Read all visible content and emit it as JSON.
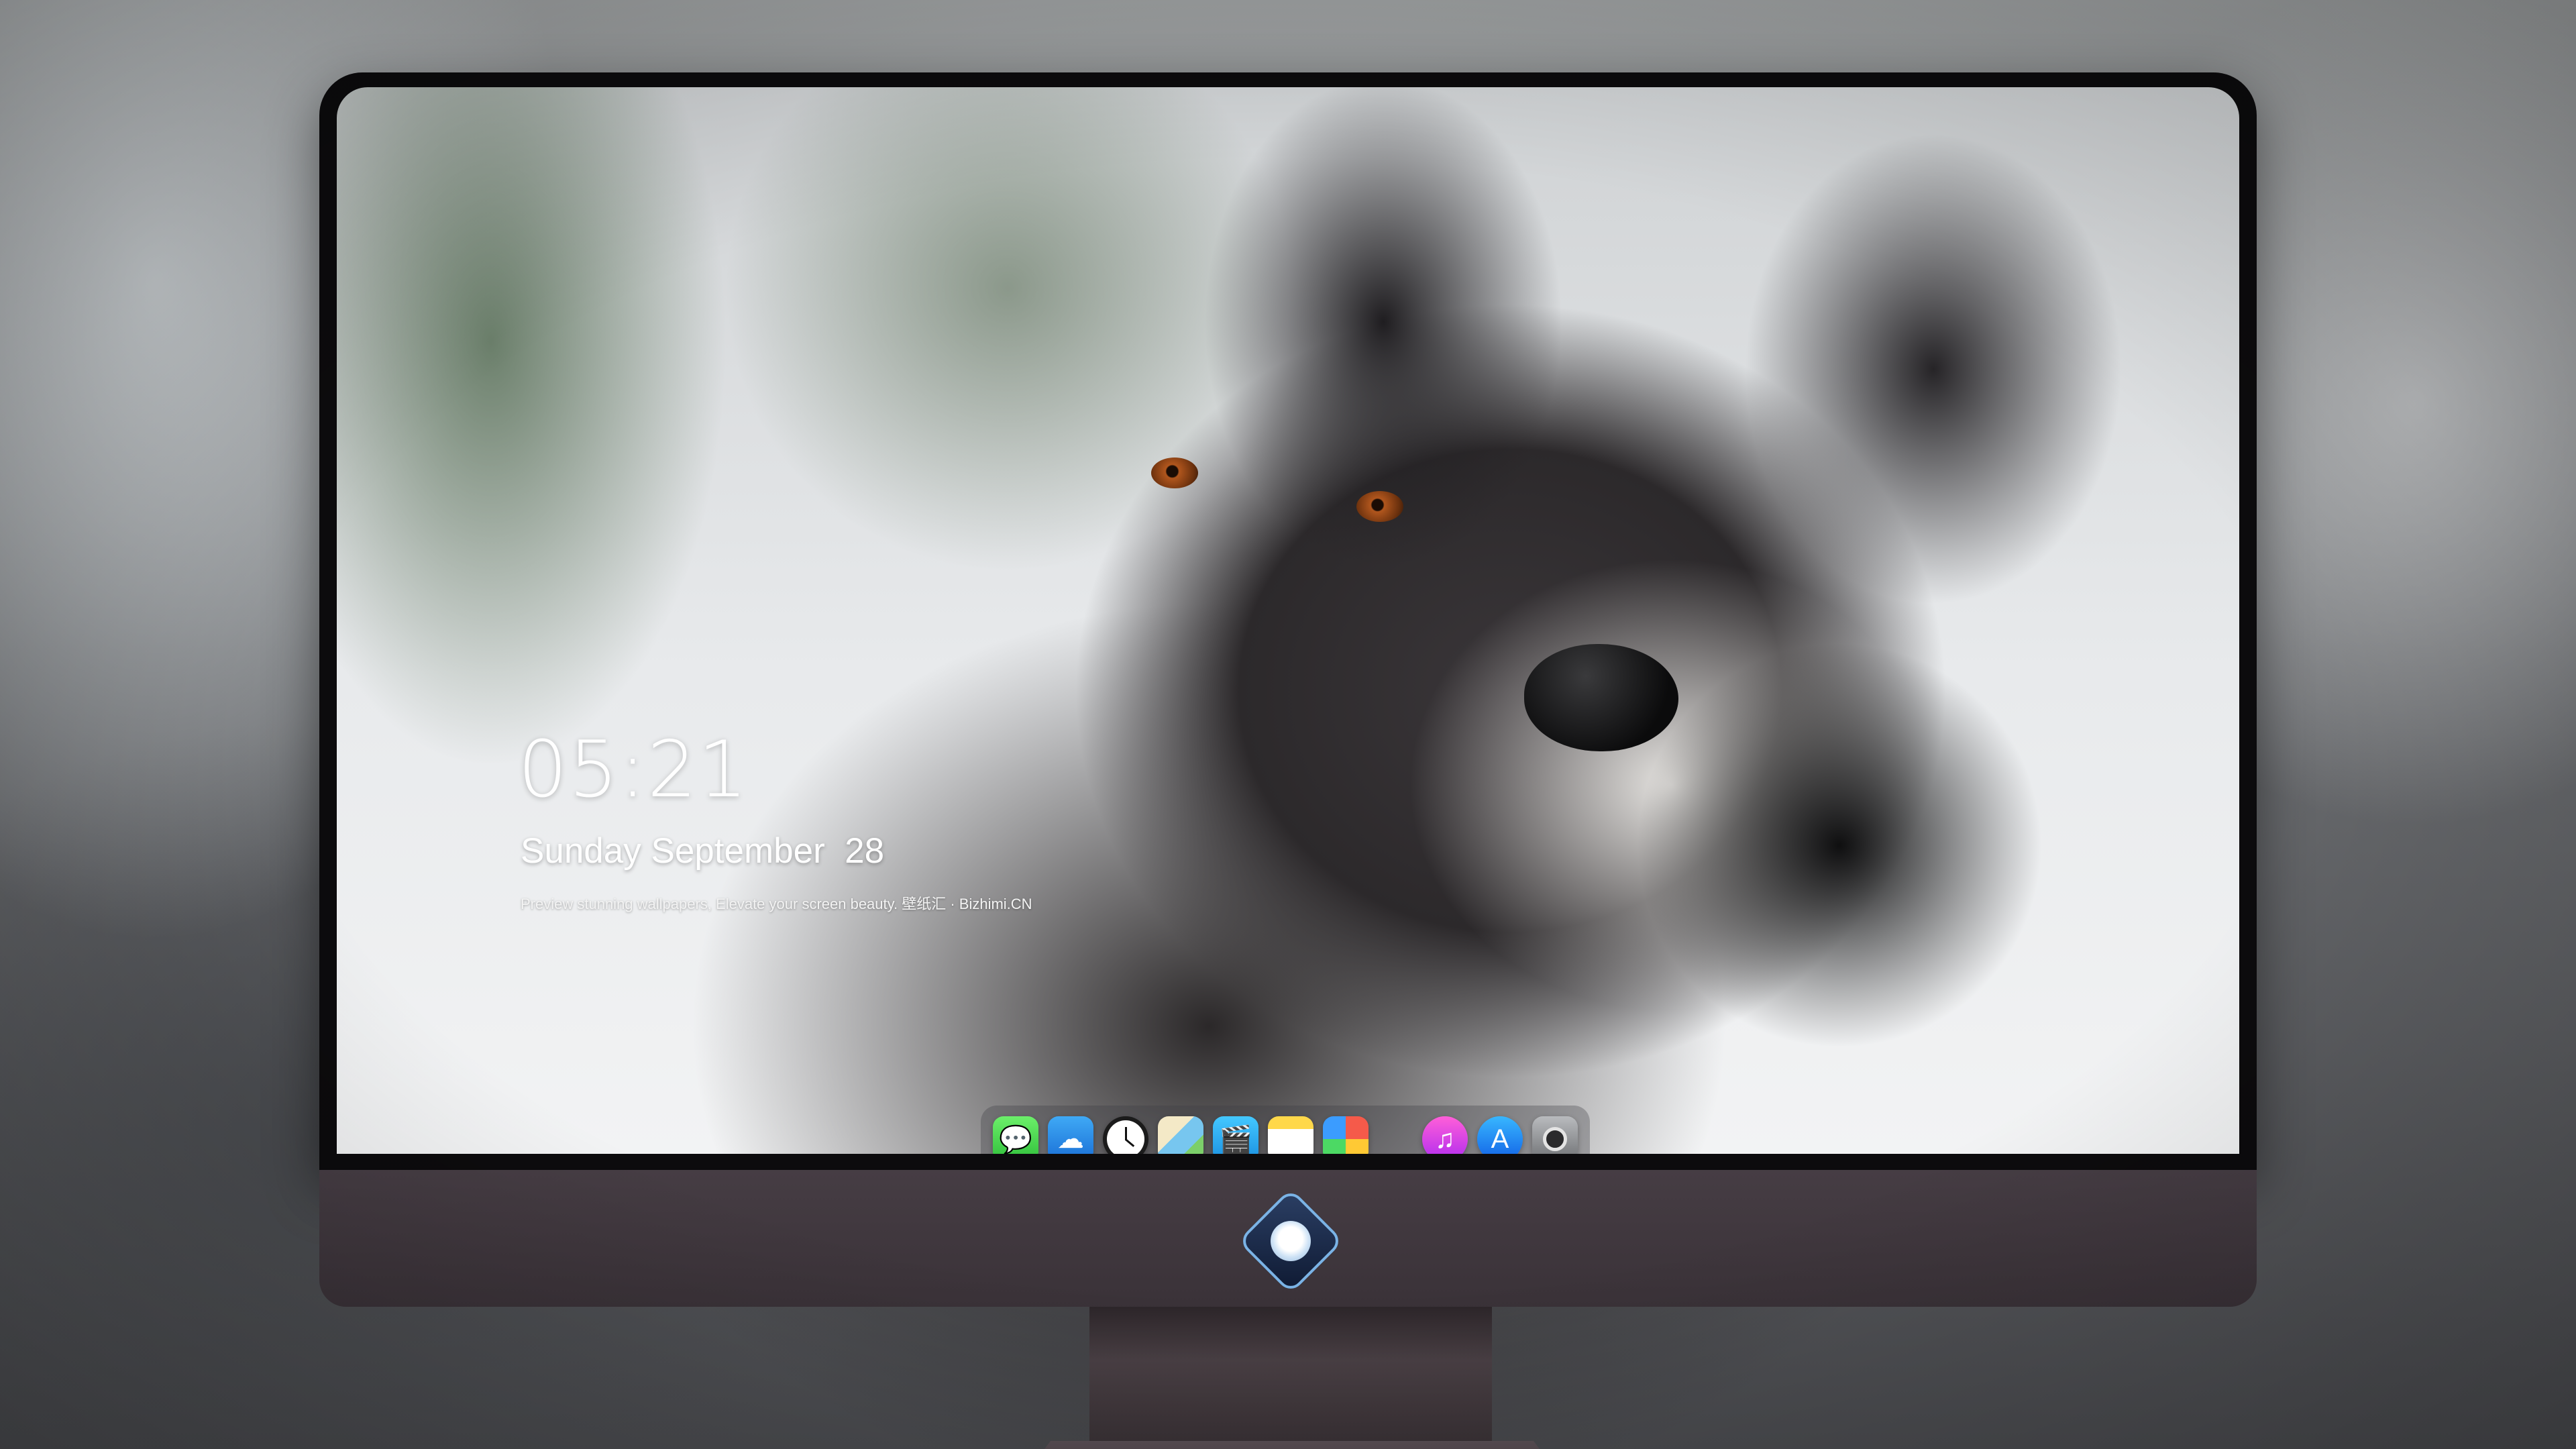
{
  "lock_screen": {
    "time": "05:21",
    "date": "Sunday September  28",
    "tagline": "Preview stunning wallpapers, Elevate your screen beauty. 壁纸汇 · Bizhimi.CN"
  },
  "dock": {
    "icons": [
      {
        "name": "messages-icon",
        "glyph": "💬"
      },
      {
        "name": "weather-icon",
        "glyph": "☁"
      },
      {
        "name": "clock-icon",
        "glyph": ""
      },
      {
        "name": "maps-icon",
        "glyph": ""
      },
      {
        "name": "clips-icon",
        "glyph": "🎬"
      },
      {
        "name": "notes-icon",
        "glyph": ""
      },
      {
        "name": "photos-icon",
        "glyph": ""
      },
      {
        "name": "music-icon",
        "glyph": "♫"
      },
      {
        "name": "app-store-icon",
        "glyph": "A"
      },
      {
        "name": "camera-icon",
        "glyph": ""
      }
    ]
  },
  "colors": {
    "clock_text": "#ffffff",
    "chin": "#463d44",
    "bezel": "#0c0b0d"
  }
}
